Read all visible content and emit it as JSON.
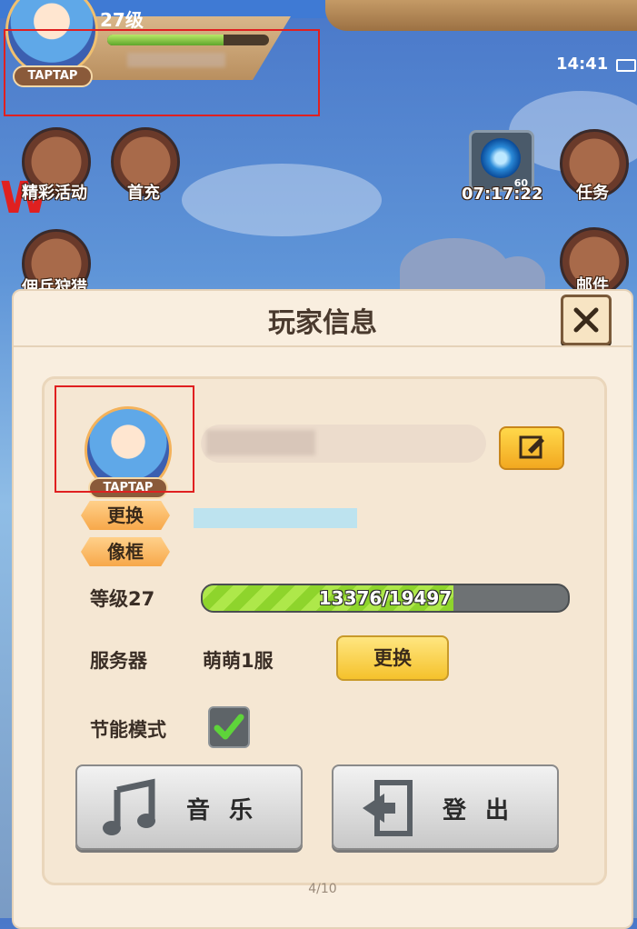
{
  "hud": {
    "level": "27级",
    "exp_fraction": 0.72,
    "avatar_badge": "TAPTAP",
    "clock": "14:41"
  },
  "side_icons": {
    "events": "精彩活动",
    "first_recharge": "首充",
    "mercenary": "佣兵狩猎",
    "quest": "任务",
    "mail": "邮件"
  },
  "timer": {
    "count": "60",
    "time": "07:17:22"
  },
  "dialog": {
    "title": "玩家信息",
    "avatar_badge": "TAPTAP",
    "change_avatar_label": "更换",
    "frame_label": "像框",
    "level_label": "等级27",
    "exp_text": "13376/19497",
    "exp_current": 13376,
    "exp_max": 19497,
    "server_label": "服务器",
    "server_name": "萌萌1服",
    "server_change_label": "更换",
    "power_saving_label": "节能模式",
    "power_saving_checked": true,
    "music_label": "音 乐",
    "logout_label": "登 出",
    "page_indicator": "4/10"
  },
  "colors": {
    "highlight": "#e02020",
    "exp_green": "#8ed42c",
    "panel_bg": "#f9eedf"
  },
  "icons": [
    "close-icon",
    "edit-icon",
    "music-note-icon",
    "logout-icon",
    "checkmark-icon"
  ]
}
